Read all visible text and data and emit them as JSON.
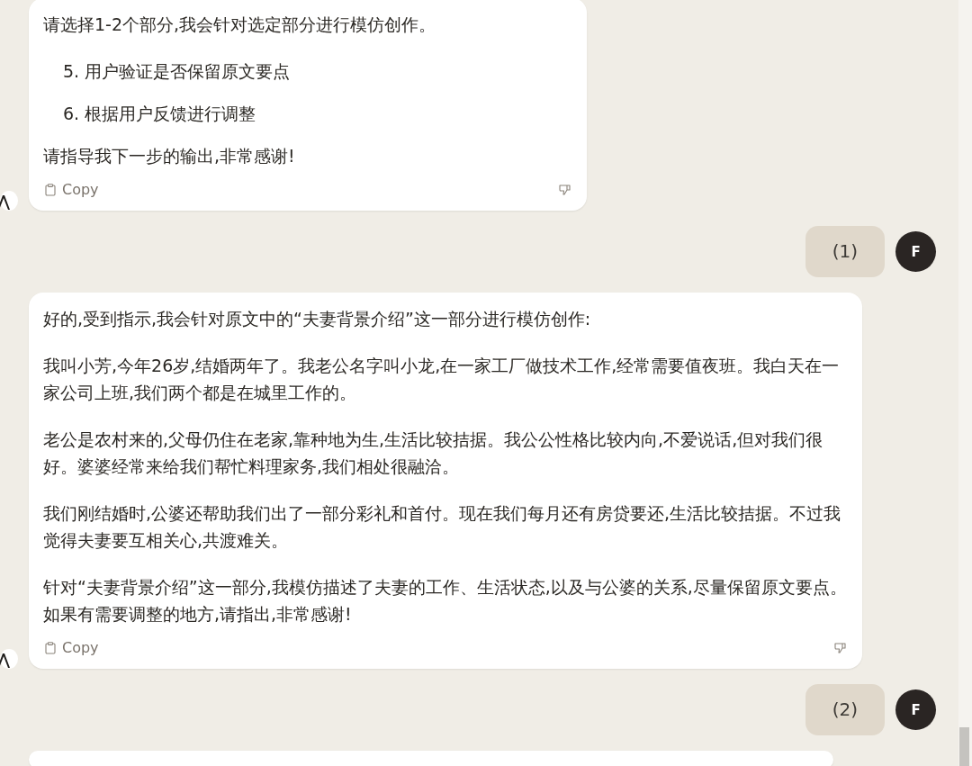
{
  "messages": [
    {
      "kind": "assistant",
      "blocks": [
        {
          "kind": "p",
          "text": "请选择1-2个部分,我会针对选定部分进行模仿创作。"
        },
        {
          "kind": "item",
          "number": "5.",
          "text": "用户验证是否保留原文要点"
        },
        {
          "kind": "item",
          "number": "6.",
          "text": "根据用户反馈进行调整"
        },
        {
          "kind": "p",
          "text": "请指导我下一步的输出,非常感谢!"
        }
      ],
      "copy_label": "Copy"
    },
    {
      "kind": "user",
      "text": "(1)",
      "avatar": "F"
    },
    {
      "kind": "assistant",
      "blocks": [
        {
          "kind": "p",
          "text": "好的,受到指示,我会针对原文中的“夫妻背景介绍”这一部分进行模仿创作:"
        },
        {
          "kind": "p",
          "text": "我叫小芳,今年26岁,结婚两年了。我老公名字叫小龙,在一家工厂做技术工作,经常需要值夜班。我白天在一家公司上班,我们两个都是在城里工作的。"
        },
        {
          "kind": "p",
          "text": "老公是农村来的,父母仍住在老家,靠种地为生,生活比较拮据。我公公性格比较内向,不爱说话,但对我们很好。婆婆经常来给我们帮忙料理家务,我们相处很融洽。"
        },
        {
          "kind": "p",
          "text": "我们刚结婚时,公婆还帮助我们出了一部分彩礼和首付。现在我们每月还有房贷要还,生活比较拮据。不过我觉得夫妻要互相关心,共渡难关。"
        },
        {
          "kind": "p",
          "text": "针对“夫妻背景介绍”这一部分,我模仿描述了夫妻的工作、生活状态,以及与公婆的关系,尽量保留原文要点。如果有需要调整的地方,请指出,非常感谢!"
        }
      ],
      "copy_label": "Copy"
    },
    {
      "kind": "user",
      "text": "(2)",
      "avatar": "F"
    },
    {
      "kind": "assistant"
    }
  ]
}
